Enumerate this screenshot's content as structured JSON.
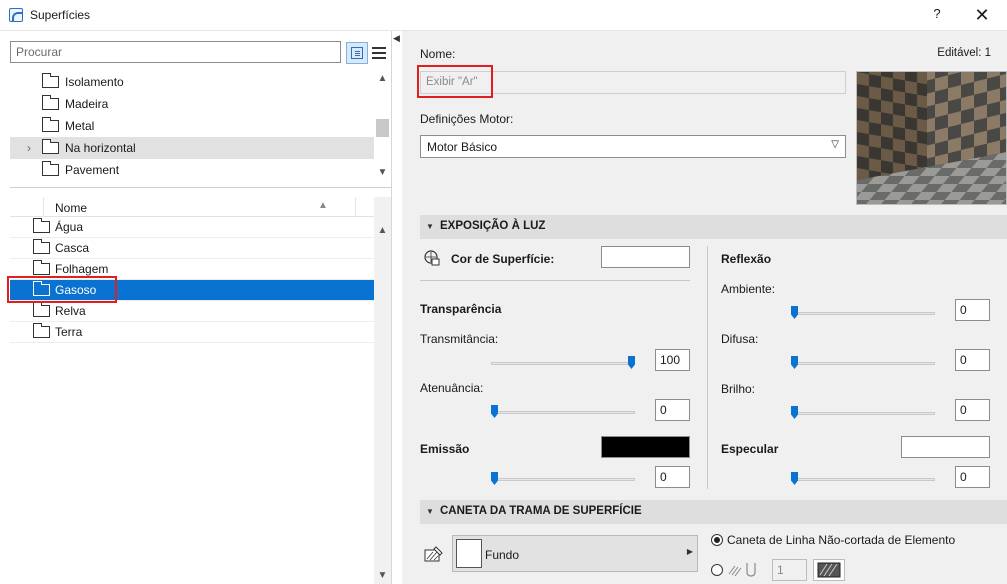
{
  "window": {
    "title": "Superfícies",
    "help_label": "?",
    "close_label": "✕"
  },
  "left_panel": {
    "search_placeholder": "Procurar",
    "folders": [
      {
        "label": "Isolamento",
        "selected": false,
        "expander": false
      },
      {
        "label": "Madeira",
        "selected": false,
        "expander": false
      },
      {
        "label": "Metal",
        "selected": false,
        "expander": false
      },
      {
        "label": "Na horizontal",
        "selected": true,
        "expander": true
      },
      {
        "label": "Pavement",
        "selected": false,
        "expander": false
      }
    ],
    "list_header": "Nome",
    "surfaces": [
      {
        "label": "Água",
        "selected": false
      },
      {
        "label": "Casca",
        "selected": false
      },
      {
        "label": "Folhagem",
        "selected": false
      },
      {
        "label": "Gasoso",
        "selected": true
      },
      {
        "label": "Relva",
        "selected": false
      },
      {
        "label": "Terra",
        "selected": false
      }
    ]
  },
  "right_panel": {
    "name_label": "Nome:",
    "editable_label": "Editável: 1",
    "name_placeholder": "Exibir \"Ar\"",
    "engine_label": "Definições Motor:",
    "engine_value": "Motor Básico",
    "light_section": {
      "title": "EXPOSIÇÃO À LUZ",
      "surface_color_label": "Cor de Superfície:",
      "surface_color": "#ffffff",
      "transparency_label": "Transparência",
      "transmittance_label": "Transmitância:",
      "transmittance_value": "100",
      "transmittance_fraction": 1.0,
      "attenuation_label": "Atenuância:",
      "attenuation_value": "0",
      "attenuation_fraction": 0,
      "emission_label": "Emissão",
      "emission_color": "#000000",
      "emission_value": "0",
      "emission_fraction": 0,
      "reflection_label": "Reflexão",
      "ambient_label": "Ambiente:",
      "ambient_value": "0",
      "ambient_fraction": 0,
      "diffuse_label": "Difusa:",
      "diffuse_value": "0",
      "diffuse_fraction": 0,
      "brightness_label": "Brilho:",
      "brightness_value": "0",
      "brightness_fraction": 0,
      "specular_label": "Especular",
      "specular_color": "#ffffff",
      "specular_value": "0",
      "specular_fraction": 0
    },
    "pen_section": {
      "title": "CANETA DA TRAMA DE SUPERFÍCIE",
      "background_label": "Fundo",
      "radio_element_pen": "Caneta de Linha Não-cortada de Elemento",
      "pen_number": "1"
    }
  },
  "colors": {
    "accent": "#0a73d1",
    "highlight_box": "#e02020",
    "section_bar": "#dedede"
  }
}
